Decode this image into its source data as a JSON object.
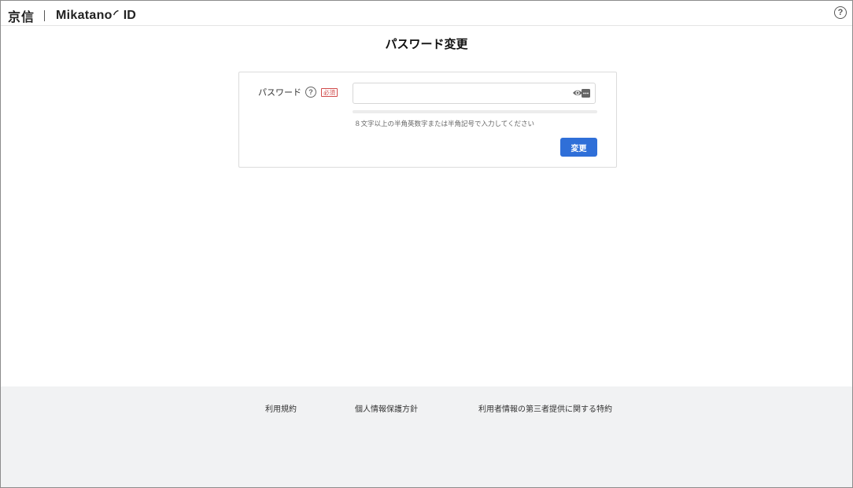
{
  "header": {
    "brand_kyoshin": "京信",
    "brand_product": "Mikatano",
    "brand_id": "ID",
    "help_glyph": "?",
    "help_icon": "question-circle-icon"
  },
  "page": {
    "title": "パスワード変更"
  },
  "form": {
    "password_label": "パスワード",
    "label_help_glyph": "?",
    "label_help_icon": "question-circle-icon",
    "required_badge": "必須",
    "password_value": "",
    "password_placeholder": "",
    "toggle_icon": "eye-icon",
    "hint": "８文字以上の半角英数字または半角記号で入力してください",
    "strength_level": 0,
    "submit_label": "変更"
  },
  "footer": {
    "links": [
      "利用規約",
      "個人情報保護方針",
      "利用者情報の第三者提供に関する特約"
    ]
  },
  "colors": {
    "accent": "#2f6fd8",
    "required": "#d14b4b",
    "footer_bg": "#f1f2f3"
  }
}
